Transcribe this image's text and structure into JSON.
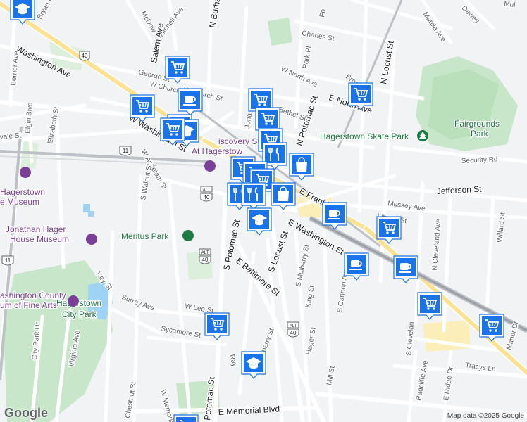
{
  "streets": {
    "washington_ave": "Washington Ave",
    "w_washington_st": "W Washington St",
    "e_washington_st": "E Washington St",
    "w_church_st_top": "W Church St",
    "w_church_st": "W Church St",
    "george_st": "George St",
    "mitchell_ave": "Mitchell Ave",
    "salem_ave": "Salem Ave",
    "n_burhans": "N Burhans",
    "bryan_pl": "Bryan Pl",
    "berner_ave": "Berner Ave",
    "elgin_blvd": "Elgin Blvd",
    "elizabeth_st": "Elizabeth St",
    "vale_st": "vale St",
    "w_antietam_st": "W Antietam St",
    "s_walnut_st": "S Walnut St",
    "s_potomac_st": "S Potomac St",
    "s_potomac_st_lower": "S Potomac St",
    "e_franklin": "E Frankl",
    "s_locust_st": "S Locust St",
    "e_baltimore_st": "E Baltimore St",
    "s_mulberry_st": "S Mulberry St",
    "s_mulberry_st_lower": "S Mulberry St",
    "king_st": "King St",
    "hager_st": "Hager St",
    "mill_st": "Mill St",
    "s_cannon_ave": "S Cannon Ave",
    "s_cleveland": "S Clevelan",
    "n_cleveland_ave": "N Cleveland Ave",
    "willard_st": "Willard St",
    "radcliffe_ave": "Radcliffe Ave",
    "e_ridge_dr": "E Ridge Dr",
    "tracys_ln": "Tracys Ln",
    "manor_dr": "Manor Dr",
    "w_lee_st": "W Lee St",
    "sycamore_st": "Sycamore St",
    "surrey_ave": "Surrey Ave",
    "key_st": "Key St",
    "virginia_ave": "Virginia Ave",
    "city_park_dr": "City Park Dr",
    "w_memorial_blvd": "W Memorial Blvd",
    "e_memorial_blvd": "E Memorial Blvd",
    "chestnut_st": "Chestnut St",
    "potomac_st_bottom": "Potomac St",
    "ray": "Ray",
    "charles_st": "Charles St",
    "w_north_ave": "W North Ave",
    "park_pl": "Park Pl",
    "broadway": "Broadway",
    "n_locust_st": "N Locust St",
    "e_north_ave": "E North Ave",
    "n_potomac_st": "N Potomac St",
    "jefferson_st": "Jefferson St",
    "mussey_ave": "Mussey Ave",
    "liberty_st": "Liberty St",
    "security_rd": "Security Rd",
    "e_bethel_st": "Bethel St",
    "jonathan": "Jona",
    "mcdowell": "McDow",
    "manila_ave": "Manila Ave",
    "dewey": "Dewey",
    "mul": "Mul",
    "fo": "Fo",
    "ave_frag": "ve"
  },
  "route_shields": {
    "us40_top": "40",
    "us11_left": "11",
    "us11_bottom": "11",
    "alt_label": "ALT",
    "alt40_upper": "40",
    "alt40_mid": "40",
    "alt40_lower": "40"
  },
  "places": {
    "hagerstown_skate_park": "Hagerstown Skate Park",
    "fairgrounds_park_1": "Fairgrounds",
    "fairgrounds_park_2": "Park",
    "meritus_park": "Meritus Park",
    "hagerstown_city_park_1": "Hagerstown",
    "hagerstown_city_park_2": "City Park",
    "discovery_station_1": "iscovery Sta",
    "discovery_station_2": "At Hagerstow",
    "hagerstown_museum_1": "Hagerstown",
    "hagerstown_museum_2": "e Museum",
    "jonathan_hager_1": "Jonathan Hager",
    "jonathan_hager_2": "House Museum",
    "washington_county_1": "ashington County",
    "washington_county_2": "um of Fine Arts"
  },
  "markers": [
    {
      "type": "school",
      "icon": "graduation-cap-icon"
    },
    {
      "type": "grocery",
      "icon": "shopping-cart-icon"
    },
    {
      "type": "cafe",
      "icon": "coffee-cup-icon"
    },
    {
      "type": "restaurant",
      "icon": "fork-knife-icon"
    },
    {
      "type": "shopping",
      "icon": "shopping-bag-icon"
    }
  ],
  "colors": {
    "marker_blue": "#1a73e8",
    "park_green": "#c8e6c9",
    "highway": "#9aa0a6",
    "water": "#9fd3f5",
    "poi_purple": "#7b3f98"
  },
  "attribution": "Map data ©2025 Google",
  "logo": "Google"
}
